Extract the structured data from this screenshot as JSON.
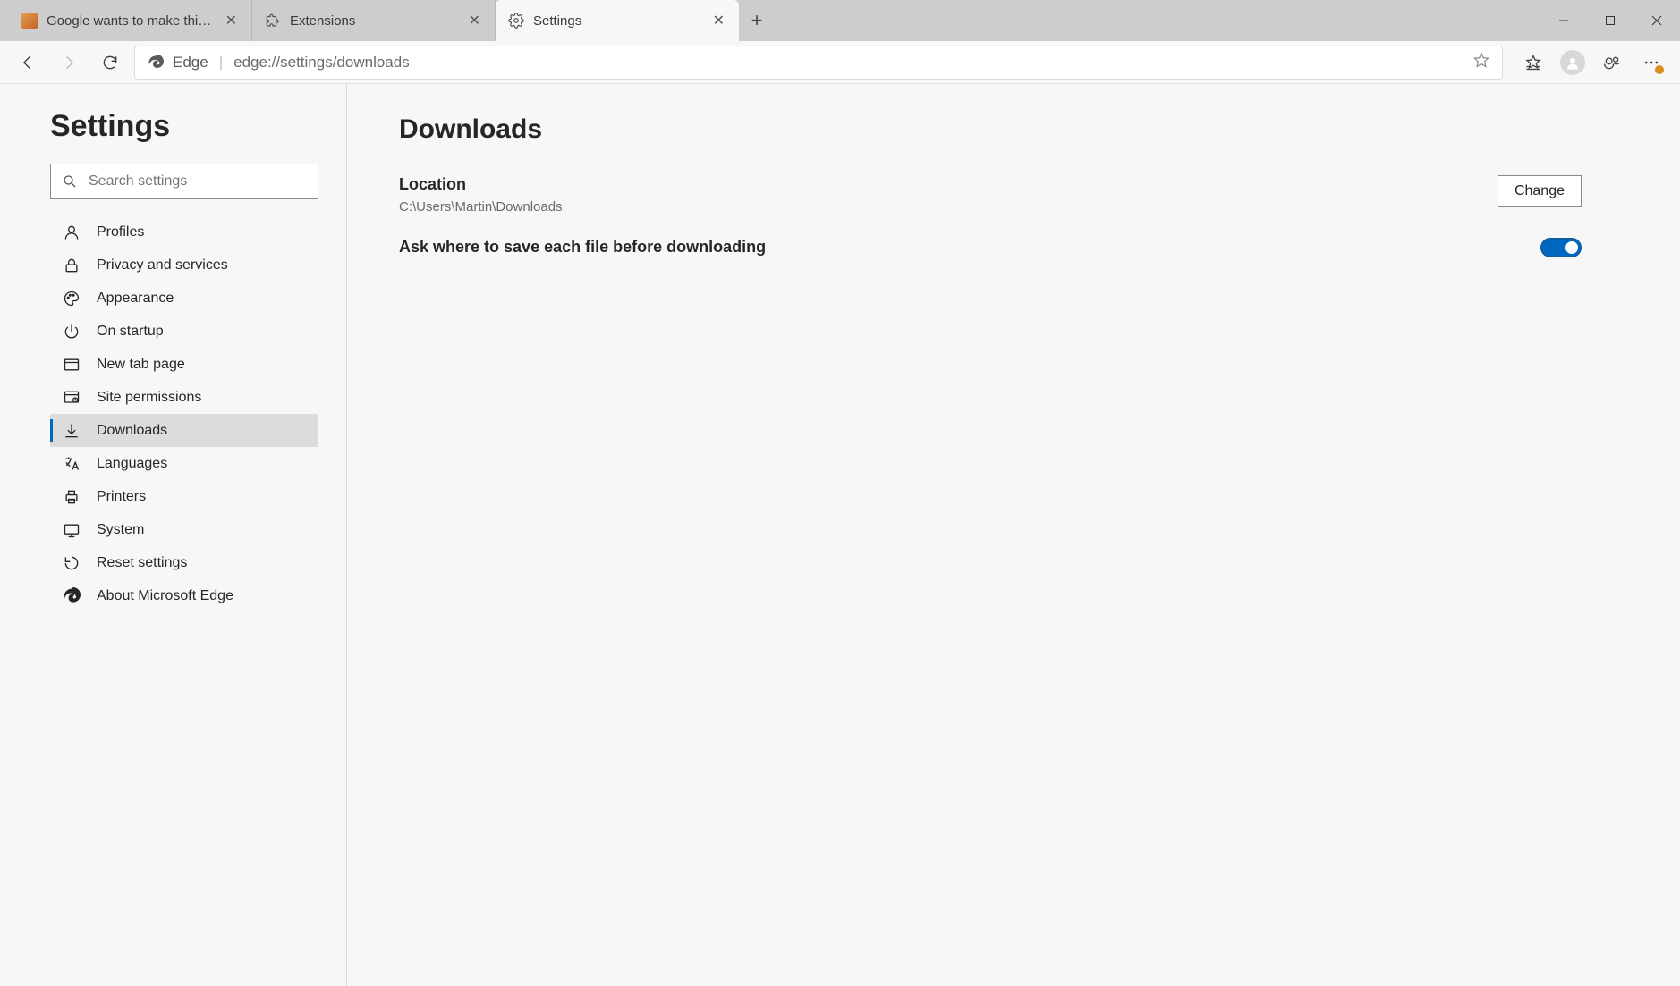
{
  "tabs": [
    {
      "title": "Google wants to make third-par"
    },
    {
      "title": "Extensions"
    },
    {
      "title": "Settings"
    }
  ],
  "address": {
    "scheme_label": "Edge",
    "url": "edge://settings/downloads"
  },
  "sidebar": {
    "title": "Settings",
    "search_placeholder": "Search settings",
    "items": [
      {
        "label": "Profiles"
      },
      {
        "label": "Privacy and services"
      },
      {
        "label": "Appearance"
      },
      {
        "label": "On startup"
      },
      {
        "label": "New tab page"
      },
      {
        "label": "Site permissions"
      },
      {
        "label": "Downloads"
      },
      {
        "label": "Languages"
      },
      {
        "label": "Printers"
      },
      {
        "label": "System"
      },
      {
        "label": "Reset settings"
      },
      {
        "label": "About Microsoft Edge"
      }
    ]
  },
  "main": {
    "heading": "Downloads",
    "location_label": "Location",
    "location_path": "C:\\Users\\Martin\\Downloads",
    "change_label": "Change",
    "ask_label": "Ask where to save each file before downloading"
  }
}
